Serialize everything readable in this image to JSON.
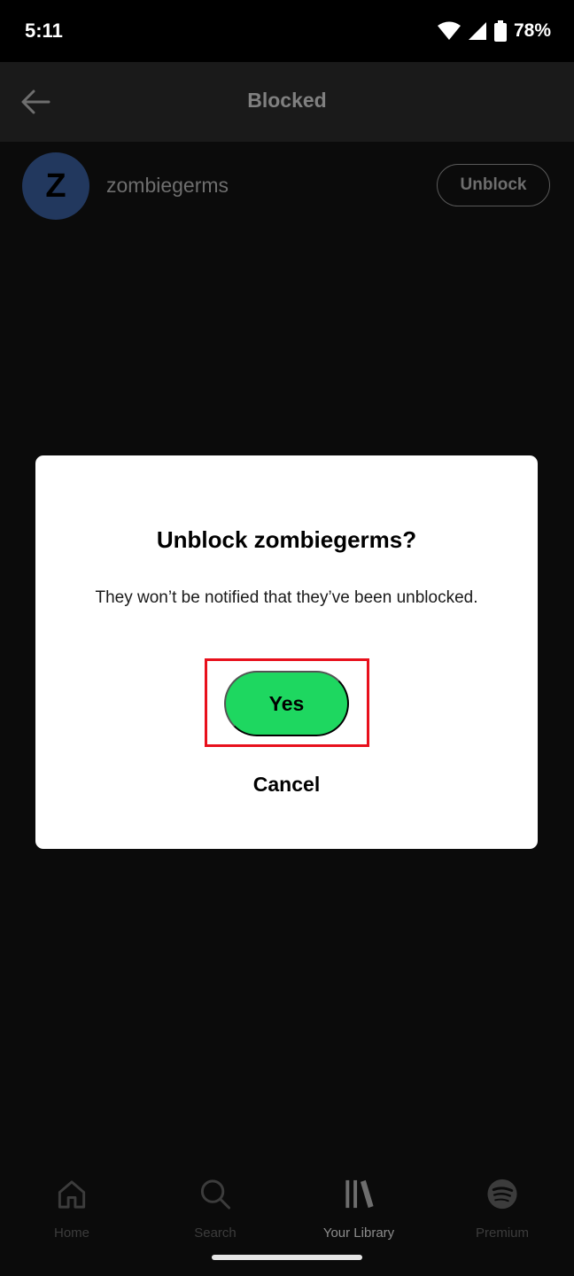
{
  "status_bar": {
    "time": "5:11",
    "battery": "78%",
    "icons": [
      "wifi-icon",
      "cell-signal-icon",
      "battery-icon"
    ]
  },
  "top_bar": {
    "title": "Blocked",
    "back_icon": "arrow-left-icon"
  },
  "blocked_list": [
    {
      "avatar_letter": "Z",
      "username": "zombiegerms",
      "action_label": "Unblock"
    }
  ],
  "dialog": {
    "title": "Unblock zombiegerms?",
    "message": "They won’t be notified that they’ve been unblocked.",
    "confirm_label": "Yes",
    "cancel_label": "Cancel"
  },
  "bottom_nav": {
    "items": [
      {
        "label": "Home",
        "icon": "home-icon"
      },
      {
        "label": "Search",
        "icon": "search-icon"
      },
      {
        "label": "Your Library",
        "icon": "library-icon"
      },
      {
        "label": "Premium",
        "icon": "spotify-icon"
      }
    ]
  },
  "colors": {
    "accent": "#1ed760",
    "highlight": "#e8101c",
    "dialog_background": "#ffffff",
    "screen_background": "#0b0b0b",
    "avatar_background": "#22385e"
  }
}
